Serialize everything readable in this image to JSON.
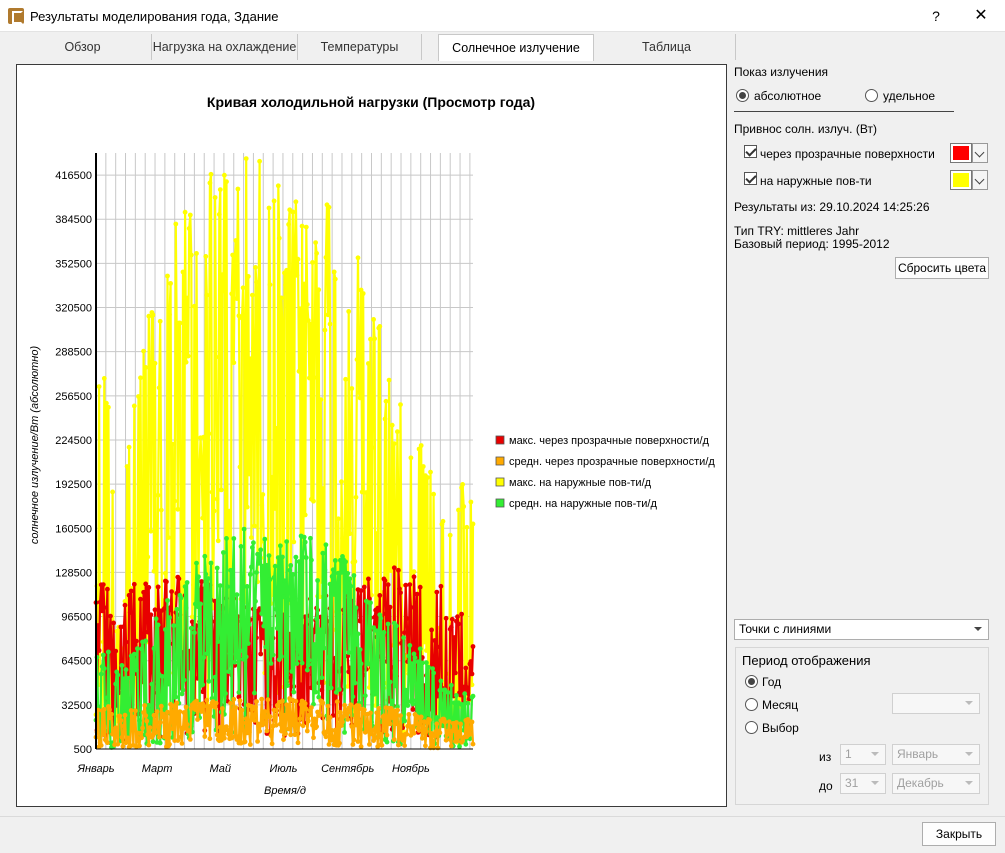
{
  "window": {
    "title": "Результаты моделирования года, Здание",
    "help": "?",
    "close": "✕"
  },
  "tabs": [
    {
      "label": "Обзор"
    },
    {
      "label": "Нагрузка на охлаждение"
    },
    {
      "label": "Температуры"
    },
    {
      "label": "Солнечное излучение"
    },
    {
      "label": "Таблица"
    }
  ],
  "active_tab": 3,
  "side": {
    "display_title": "Показ излучения",
    "radio_absolute": "абсолютное",
    "radio_specific": "удельное",
    "gain_title": "Привнос солн. излуч. (Вт)",
    "check_transparent": "через прозрачные поверхности",
    "check_external": "на наружные пов-ти",
    "color_transparent": "#ff0000",
    "color_external": "#ffff00",
    "results_from": "Результаты из: 29.10.2024 14:25:26",
    "try_type": "Тип TRY: mittleres Jahr",
    "base_period": "Базовый период: 1995-2012",
    "reset_colors": "Сбросить цвета",
    "style_combo": "Точки с линиями",
    "period_title": "Период отображения",
    "period_year": "Год",
    "period_month": "Месяц",
    "period_select": "Выбор",
    "from_label": "из",
    "to_label": "до",
    "from_day": "1",
    "from_month": "Январь",
    "to_day": "31",
    "to_month": "Декабрь"
  },
  "footer": {
    "close_button": "Закрыть"
  },
  "chart_data": {
    "type": "line",
    "title": "Кривая холодильной нагрузки (Просмотр года)",
    "xlabel": "Время/д",
    "ylabel": "солнечное излучение/Вт (абсолютно)",
    "xlim": [
      1,
      365
    ],
    "ylim": [
      500,
      432500
    ],
    "yticks": [
      500,
      32500,
      64500,
      96500,
      128500,
      160500,
      192500,
      224500,
      256500,
      288500,
      320500,
      352500,
      384500,
      416500
    ],
    "xtick_labels": [
      "Январь",
      "Март",
      "Май",
      "Июль",
      "Сентябрь",
      "Ноябрь"
    ],
    "xtick_days": [
      1,
      60,
      121,
      182,
      244,
      305
    ],
    "grid": true,
    "legend_position": "right",
    "series": [
      {
        "name": "макс. через прозрачные поверхности/д",
        "color": "#e80000",
        "monthly_typical": [
          62000,
          78000,
          92000,
          88000,
          82000,
          78000,
          80000,
          85000,
          95000,
          98000,
          90000,
          70000
        ],
        "monthly_peak": [
          108000,
          128000,
          130000,
          122000,
          110000,
          102000,
          108000,
          115000,
          124000,
          132000,
          130000,
          112000
        ]
      },
      {
        "name": "средн. через прозрачные поверхности/д",
        "color": "#ffaa00",
        "monthly_typical": [
          12000,
          18000,
          22000,
          26000,
          28000,
          28000,
          27000,
          25000,
          22000,
          18000,
          14000,
          10000
        ],
        "monthly_peak": [
          26000,
          32000,
          34000,
          36000,
          38000,
          38000,
          38000,
          36000,
          32000,
          30000,
          26000,
          22000
        ]
      },
      {
        "name": "макс. на наружные пов-ти/д",
        "color": "#ffff00",
        "monthly_typical": [
          60000,
          115000,
          190000,
          260000,
          300000,
          310000,
          305000,
          270000,
          205000,
          140000,
          85000,
          50000
        ],
        "monthly_peak": [
          220000,
          300000,
          390000,
          420000,
          430000,
          428000,
          420000,
          410000,
          350000,
          285000,
          225000,
          200000
        ]
      },
      {
        "name": "средн. на наружные пов-ти/д",
        "color": "#33ee33",
        "monthly_typical": [
          15000,
          32000,
          55000,
          80000,
          105000,
          112000,
          108000,
          92000,
          65000,
          40000,
          22000,
          12000
        ],
        "monthly_peak": [
          55000,
          80000,
          115000,
          145000,
          160000,
          162000,
          160000,
          155000,
          125000,
          95000,
          70000,
          42000
        ]
      }
    ]
  }
}
